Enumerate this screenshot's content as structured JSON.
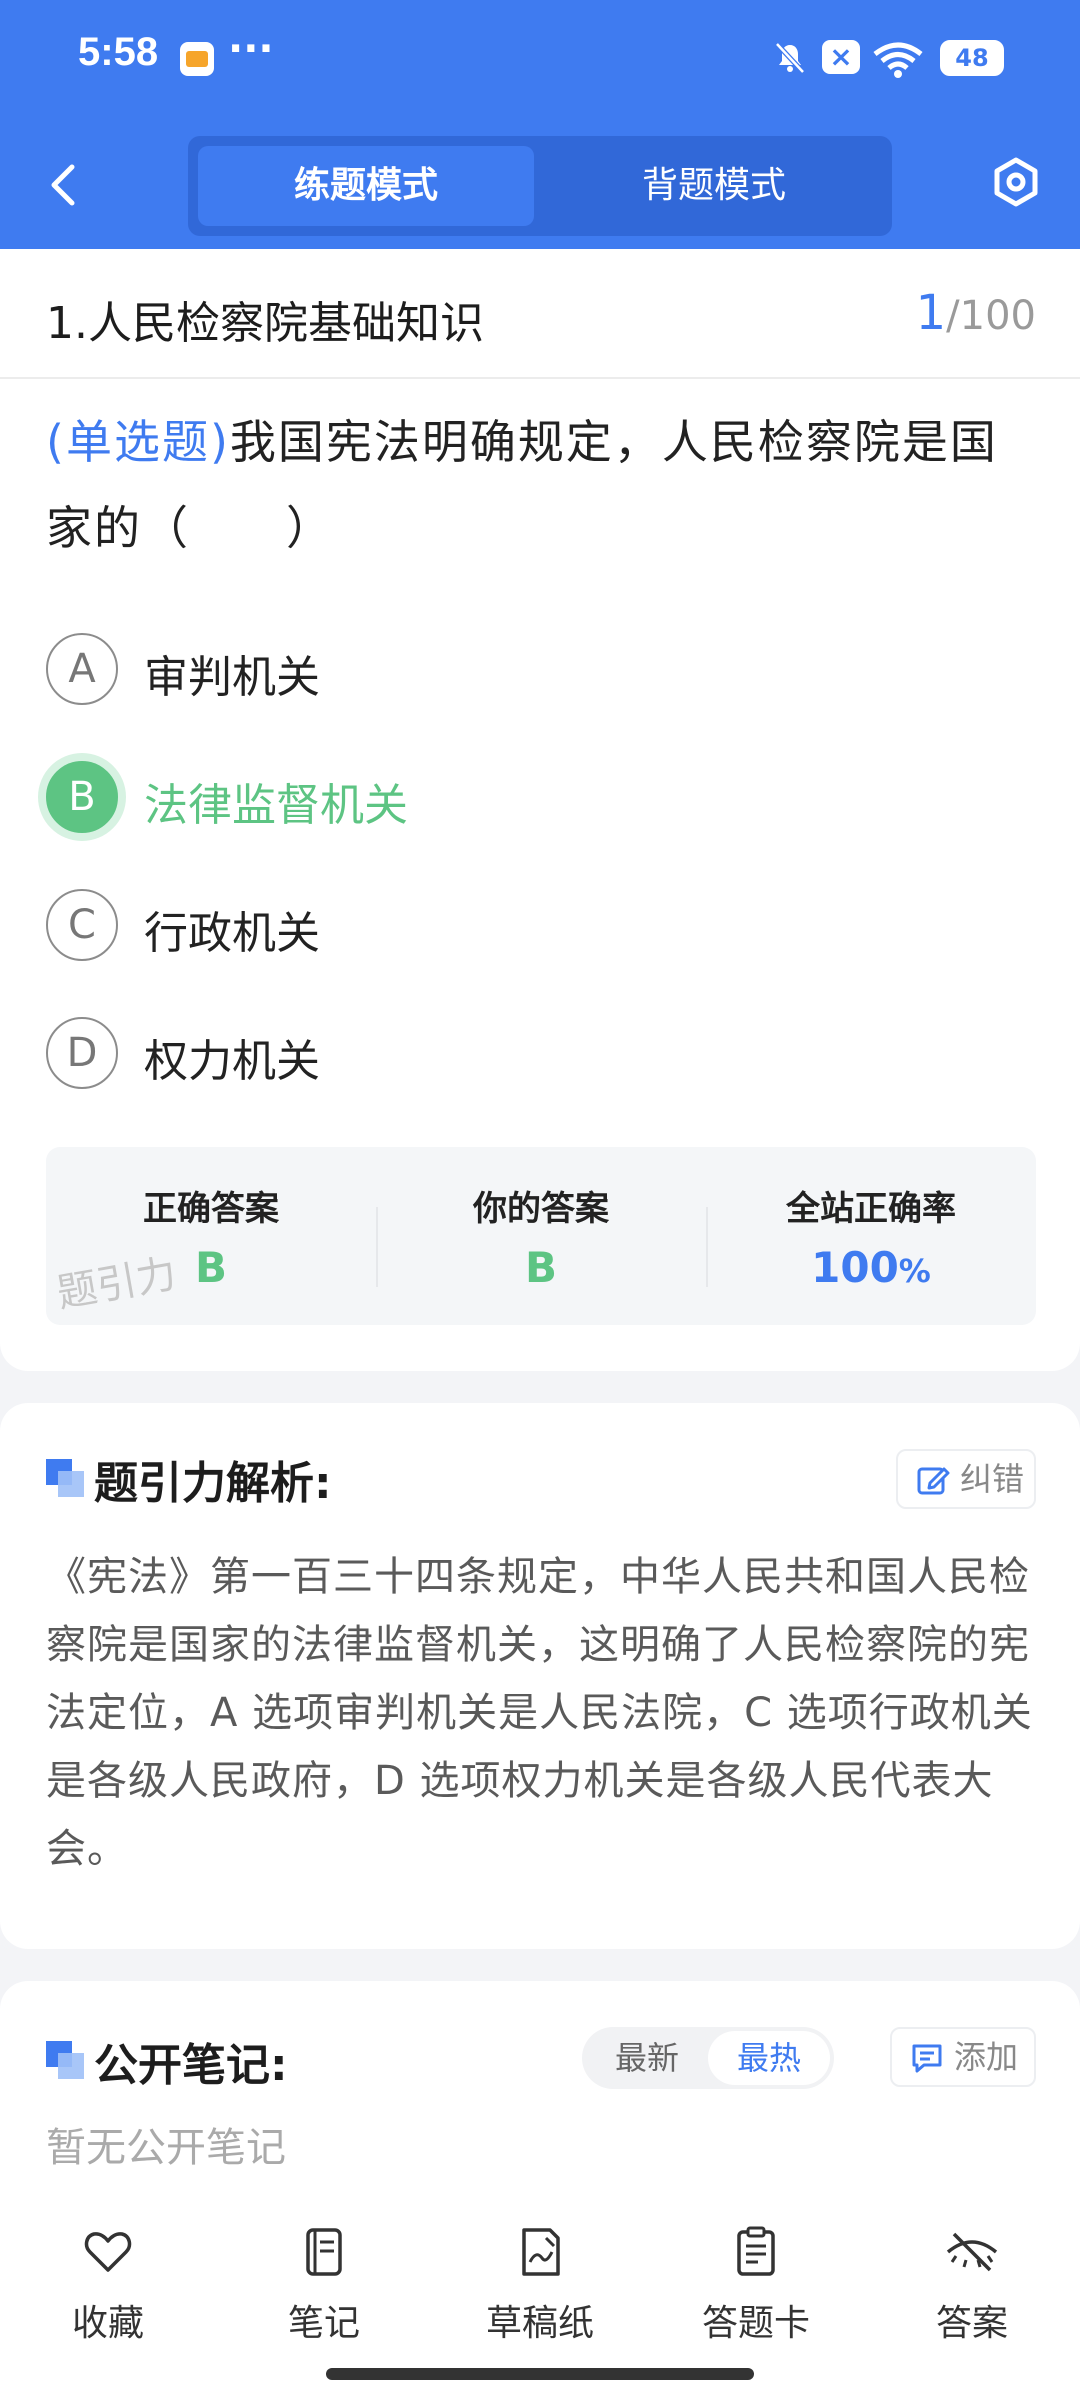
{
  "status_bar": {
    "time": "5:58",
    "overflow": "···",
    "battery": "48",
    "notif_badge": "×"
  },
  "header": {
    "modes": [
      {
        "label": "练题模式",
        "active": true
      },
      {
        "label": "背题模式",
        "active": false
      }
    ],
    "icons": {
      "back": "chevron-left-icon",
      "settings": "hexagon-settings-icon"
    }
  },
  "question": {
    "section_title": "1.人民检察院基础知识",
    "current": "1",
    "total": "/100",
    "type_tag": "(单选题)",
    "stem": "我国宪法明确规定，人民检察院是国家的（　　）",
    "options": [
      {
        "letter": "A",
        "text": "审判机关",
        "selected": false
      },
      {
        "letter": "B",
        "text": "法律监督机关",
        "selected": true
      },
      {
        "letter": "C",
        "text": "行政机关",
        "selected": false
      },
      {
        "letter": "D",
        "text": "权力机关",
        "selected": false
      }
    ]
  },
  "answer_panel": {
    "correct_label": "正确答案",
    "correct_value": "B",
    "yours_label": "你的答案",
    "yours_value": "B",
    "rate_label": "全站正确率",
    "rate_value": "100",
    "rate_unit": "%",
    "watermark": "题引力"
  },
  "analysis": {
    "title": "题引力解析:",
    "report_label": "纠错",
    "text": "《宪法》第一百三十四条规定，中华人民共和国人民检察院是国家的法律监督机关，这明确了人民检察院的宪法定位，A 选项审判机关是人民法院，C 选项行政机关是各级人民政府，D 选项权力机关是各级人民代表大会。"
  },
  "notes": {
    "title": "公开笔记:",
    "sort_latest": "最新",
    "sort_hot": "最热",
    "add_label": "添加",
    "empty_text": "暂无公开笔记"
  },
  "toolbar": [
    {
      "label": "收藏",
      "icon": "heart-icon"
    },
    {
      "label": "笔记",
      "icon": "notebook-icon"
    },
    {
      "label": "草稿纸",
      "icon": "draft-paper-icon"
    },
    {
      "label": "答题卡",
      "icon": "answer-sheet-icon"
    },
    {
      "label": "答案",
      "icon": "eye-off-icon"
    }
  ],
  "colors": {
    "brand": "#3f7bf0",
    "correct": "#5dc483",
    "muted": "#9a9a9a"
  }
}
